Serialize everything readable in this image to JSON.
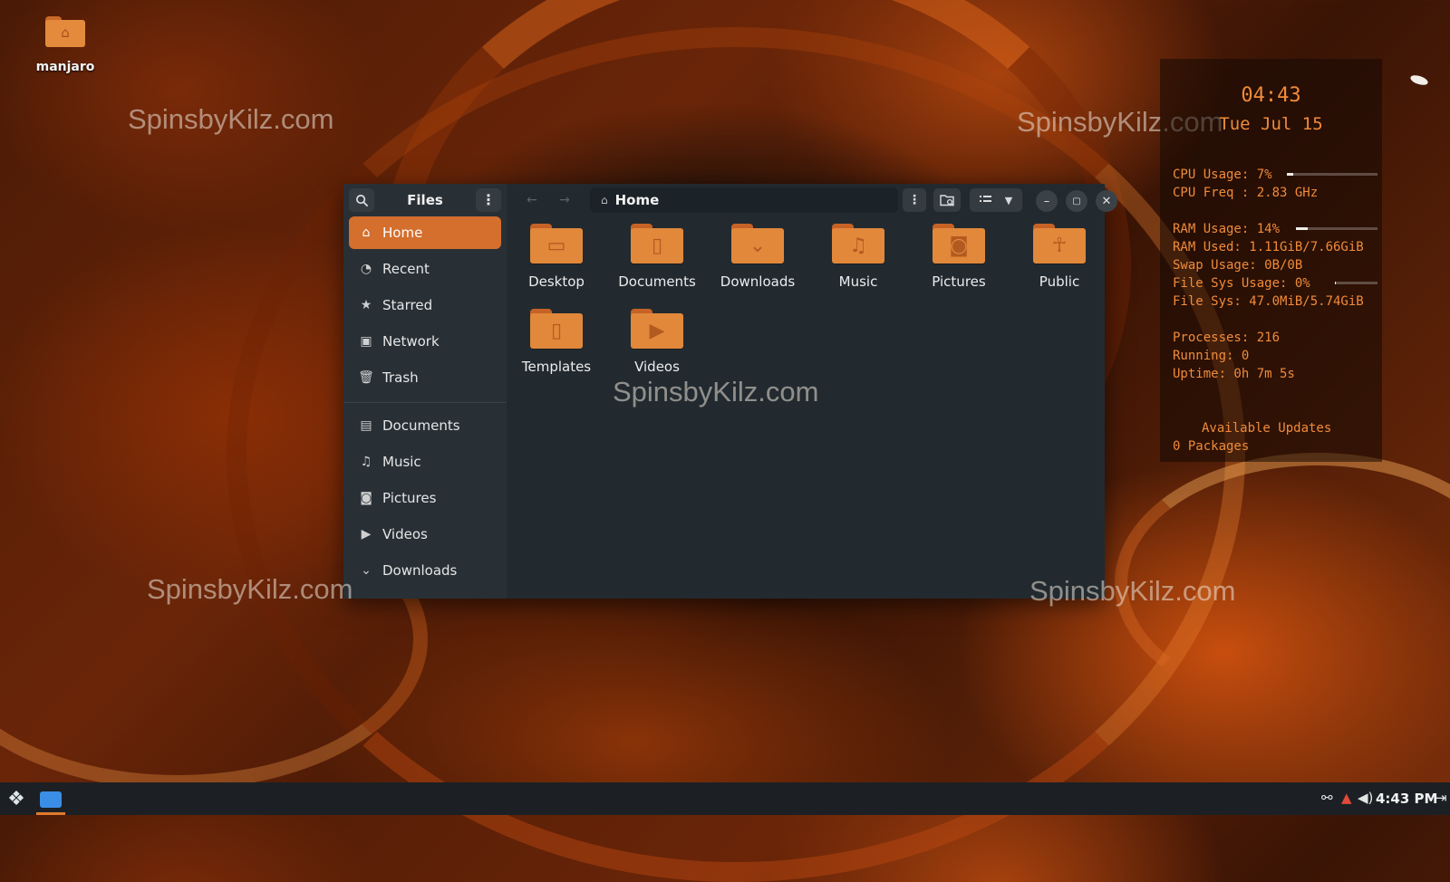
{
  "desktop": {
    "icon_label": "manjaro",
    "watermarks": [
      "SpinsbyKilz.com",
      "SpinsbyKilz.com",
      "SpinsbyKilz.com",
      "SpinsbyKilz.com",
      "SpinsbyKilz.com"
    ]
  },
  "files_window": {
    "title": "Files",
    "path": "Home",
    "sidebar": {
      "places": [
        {
          "label": "Home",
          "icon": "home-icon",
          "active": true
        },
        {
          "label": "Recent",
          "icon": "clock-icon"
        },
        {
          "label": "Starred",
          "icon": "star-icon"
        },
        {
          "label": "Network",
          "icon": "network-icon"
        },
        {
          "label": "Trash",
          "icon": "trash-icon"
        }
      ],
      "bookmarks": [
        {
          "label": "Documents",
          "icon": "document-icon"
        },
        {
          "label": "Music",
          "icon": "music-icon"
        },
        {
          "label": "Pictures",
          "icon": "camera-icon"
        },
        {
          "label": "Videos",
          "icon": "video-icon"
        },
        {
          "label": "Downloads",
          "icon": "download-icon"
        }
      ]
    },
    "folders": [
      {
        "label": "Desktop",
        "icon": "desktop-icon"
      },
      {
        "label": "Documents",
        "icon": "document-icon"
      },
      {
        "label": "Downloads",
        "icon": "download-icon"
      },
      {
        "label": "Music",
        "icon": "music-icon"
      },
      {
        "label": "Pictures",
        "icon": "camera-icon"
      },
      {
        "label": "Public",
        "icon": "person-icon"
      },
      {
        "label": "Templates",
        "icon": "template-icon"
      },
      {
        "label": "Videos",
        "icon": "video-icon"
      }
    ],
    "accent_color": "#d46f2d"
  },
  "conky": {
    "time": "04:43",
    "date": "Tue Jul 15",
    "cpu_usage": "CPU Usage: 7%",
    "cpu_usage_fraction": 0.07,
    "cpu_freq": "CPU Freq : 2.83 GHz",
    "ram_usage": "RAM Usage: 14%",
    "ram_usage_fraction": 0.14,
    "ram_used": "RAM Used: 1.11GiB/7.66GiB",
    "swap_usage": "Swap Usage: 0B/0B",
    "fs_usage": "File Sys Usage:  0%",
    "fs_usage_fraction": 0.0,
    "fs": "File Sys: 47.0MiB/5.74GiB",
    "processes": "Processes: 216",
    "running": "Running: 0",
    "uptime": "Uptime: 0h 7m 5s",
    "updates_title": "Available Updates",
    "updates_count": "0 Packages",
    "text_color": "#f08b3a"
  },
  "taskbar": {
    "clock": "4:43 PM"
  }
}
